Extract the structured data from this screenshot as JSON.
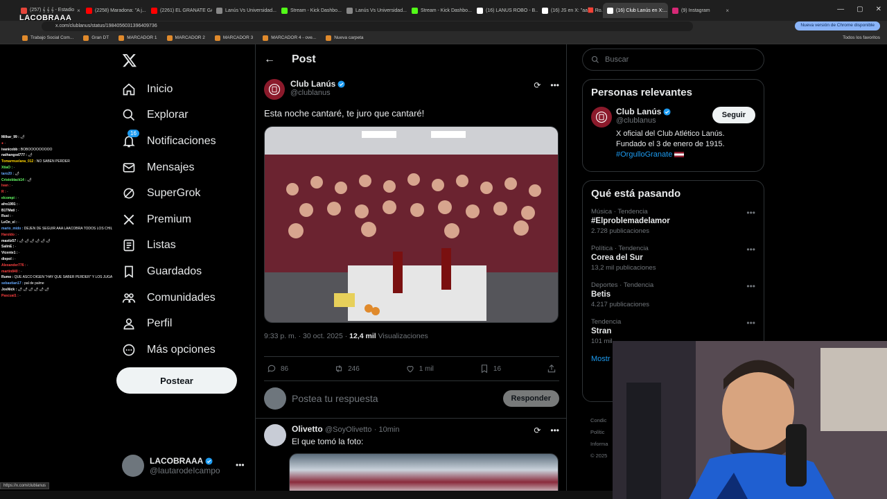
{
  "browser": {
    "tabs": [
      {
        "label": "(257) 𝄞 𝄞 𝄞 - Estadio",
        "color": "#e5453a",
        "active": false
      },
      {
        "label": "(2258) Maradona: \"A j...",
        "color": "#ff0000",
        "active": false
      },
      {
        "label": "(2261) EL GRANATE GA...",
        "color": "#ff0000",
        "active": false
      },
      {
        "label": "Lanús Vs Universidad...",
        "color": "#888888",
        "active": false
      },
      {
        "label": "Stream - Kick Dashbo...",
        "color": "#53fc18",
        "active": false
      },
      {
        "label": "Lanús Vs Universidad...",
        "color": "#888888",
        "active": false
      },
      {
        "label": "Stream - Kick Dashbo...",
        "color": "#53fc18",
        "active": false
      },
      {
        "label": "(16) LANUS ROBO - B...",
        "color": "#ffffff",
        "active": false
      },
      {
        "label": "(16) JS en X: \"aa🟥 Ro...",
        "color": "#ffffff",
        "active": false
      },
      {
        "label": "(16) Club Lanús en X:...",
        "color": "#ffffff",
        "active": true
      },
      {
        "label": "(9) Instagram",
        "color": "#d62976",
        "active": false
      }
    ],
    "url": "x.com/clublanus/status/1984056031396409736",
    "update_label": "Nueva versión de Chrome disponible",
    "bookmarks": [
      "Trabajo Social Com...",
      "Gran DT",
      "MARCADOR 1",
      "MARCADOR 2",
      "MARCADOR 3",
      "MARCADOR 4 - ove...",
      "Nueva carpeta"
    ],
    "bookmarks_right": "Todos los favoritos",
    "status_url": "https://x.com/clublanus"
  },
  "overlay": {
    "logo_text": "LACOBRAAA",
    "chat": [
      {
        "user": "Milkar_99 :",
        "color": "#ffffff",
        "msg": "🌶"
      },
      {
        "user": "● ",
        "color": "#ff4040",
        "msg": "·"
      },
      {
        "user": "ivanicobb :",
        "color": "#ffffff",
        "msg": "BOBOOOOOOOOO"
      },
      {
        "user": "nathangod777 :",
        "color": "#ffffff",
        "msg": "🌶"
      },
      {
        "user": "Tomarmuelana_012 :",
        "color": "#ffd400",
        "msg": "NO SABEN PERDER"
      },
      {
        "user": "XtiaO :",
        "color": "#66ff66",
        "msg": "·"
      },
      {
        "user": "taro20 :",
        "color": "#66aaff",
        "msg": "🌶"
      },
      {
        "user": "Cristoblack14 :",
        "color": "#66ff66",
        "msg": "🌶"
      },
      {
        "user": "Ivan :",
        "color": "#ff4040",
        "msg": "·"
      },
      {
        "user": "R :",
        "color": "#ff4040",
        "msg": "·"
      },
      {
        "user": "elcompi :",
        "color": "#66ff66",
        "msg": "·"
      },
      {
        "user": "afro1991 :",
        "color": "#ffffff",
        "msg": "·"
      },
      {
        "user": "B1TMati :",
        "color": "#ffffff",
        "msg": "·"
      },
      {
        "user": "Rusi :",
        "color": "#ffffff",
        "msg": "·"
      },
      {
        "user": "LeOn_el :",
        "color": "#ffffff",
        "msg": "·"
      },
      {
        "user": "mario_mido :",
        "color": "#66aaff",
        "msg": "DEJEN DE SEGUIR AAA LAACOBRA TODOS LOS CHILENOS 😂 😂 😂"
      },
      {
        "user": "Haroldo :",
        "color": "#ff4040",
        "msg": "·"
      },
      {
        "user": "mastiz57 :",
        "color": "#ffffff",
        "msg": "🌶 🌶 🌶 🌶 🌶 🌶"
      },
      {
        "user": "SalinE :",
        "color": "#ffffff",
        "msg": "·"
      },
      {
        "user": "Vicente1 :",
        "color": "#ffffff",
        "msg": "·"
      },
      {
        "user": "diepol :",
        "color": "#ffffff",
        "msg": "·"
      },
      {
        "user": "Alexander776 :",
        "color": "#ff4040",
        "msg": "·"
      },
      {
        "user": "martin840 :",
        "color": "#ff4040",
        "msg": "·"
      },
      {
        "user": "Rumo :",
        "color": "#ffffff",
        "msg": "QUE ASCO DIGEN \"HAY QUE SABER PERDER\" Y LOS JUGADORES DE LANUS RIENDOSE, HAY QUE SABER GANAR"
      },
      {
        "user": "sebastian17 :",
        "color": "#66aaff",
        "msg": "pal de palme"
      },
      {
        "user": "JosNick :",
        "color": "#ffffff",
        "msg": "🌶 🌶 🌶 🌶 🌶 🌶"
      },
      {
        "user": "Pascual1 :",
        "color": "#ff4040",
        "msg": "·"
      }
    ]
  },
  "nav": {
    "items": [
      {
        "label": "Inicio",
        "icon": "home-icon"
      },
      {
        "label": "Explorar",
        "icon": "search-icon"
      },
      {
        "label": "Notificaciones",
        "icon": "bell-icon",
        "badge": "16"
      },
      {
        "label": "Mensajes",
        "icon": "mail-icon"
      },
      {
        "label": "SuperGrok",
        "icon": "grok-icon"
      },
      {
        "label": "Premium",
        "icon": "x-icon"
      },
      {
        "label": "Listas",
        "icon": "list-icon"
      },
      {
        "label": "Guardados",
        "icon": "bookmark-icon"
      },
      {
        "label": "Comunidades",
        "icon": "communities-icon"
      },
      {
        "label": "Perfil",
        "icon": "user-icon"
      },
      {
        "label": "Más opciones",
        "icon": "more-icon"
      }
    ],
    "post_button": "Postear",
    "me": {
      "name": "LACOBRAAA",
      "handle": "@lautarodeIcampo"
    }
  },
  "post": {
    "header_title": "Post",
    "author": {
      "name": "Club Lanús",
      "handle": "@clublanus"
    },
    "text": "Esta noche cantaré, te juro que cantaré!",
    "time": "9:33 p. m. · 30 oct. 2025 · ",
    "views": "12,4 mil",
    "views_label": " Visualizaciones",
    "replies": "86",
    "reposts": "246",
    "likes": "1 mil",
    "bookmarks": "16",
    "reply_placeholder": "Postea tu respuesta",
    "reply_button": "Responder",
    "reply2": {
      "name": "Olivetto",
      "handle": "@SoyOlivetto",
      "time": "· 10min",
      "text": "El que tomó la foto:"
    }
  },
  "right": {
    "search_placeholder": "Buscar",
    "relevant": {
      "title": "Personas relevantes",
      "name": "Club Lanús",
      "handle": "@clublanus",
      "follow": "Seguir",
      "bio_line1": "X oficial del Club Atlético Lanús.",
      "bio_line2": "Fundado el 3 de enero de 1915.",
      "bio_tag": "#OrgulloGranate"
    },
    "trends_title": "Qué está pasando",
    "trends": [
      {
        "category": "Música · Tendencia",
        "name": "#Elproblemadelamor",
        "count": "2.728 publicaciones"
      },
      {
        "category": "Política · Tendencia",
        "name": "Corea del Sur",
        "count": "13,2 mil publicaciones"
      },
      {
        "category": "Deportes · Tendencia",
        "name": "Betis",
        "count": "4.217 publicaciones"
      },
      {
        "category": "Tendencia",
        "name": "Stran",
        "count": "101 mil"
      }
    ],
    "show_more": "Mostr",
    "footer": [
      "Condic",
      "Polític",
      "Informa",
      "© 2025"
    ]
  },
  "colors": {
    "accent": "#1d9bf0",
    "background": "#000000",
    "border": "#2f3336",
    "muted": "#71767b",
    "club": "#8b1a2b"
  }
}
